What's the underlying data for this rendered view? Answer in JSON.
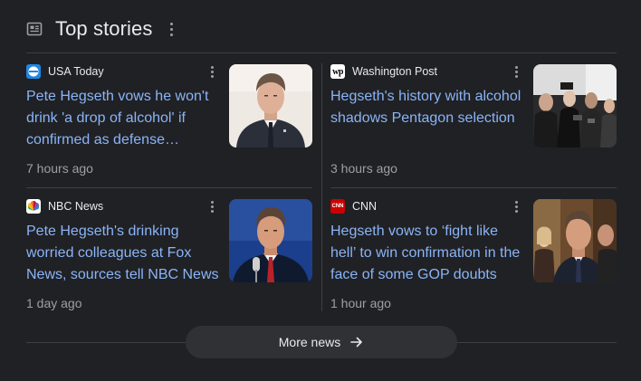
{
  "header": {
    "title": "Top stories",
    "icon": "news-icon"
  },
  "stories": [
    {
      "source": "USA Today",
      "logo_icon": "usa-today-logo",
      "logo_color": "#1e88e5",
      "headline": "Pete Hegseth vows he won't drink 'a drop of alcohol' if confirmed as defense…",
      "time": "7 hours ago"
    },
    {
      "source": "Washington Post",
      "logo_icon": "washington-post-logo",
      "logo_text": "wp",
      "logo_color": "#ffffff",
      "headline": "Hegseth's history with alcohol shadows Pentagon selection",
      "time": "3 hours ago"
    },
    {
      "source": "NBC News",
      "logo_icon": "nbc-peacock-logo",
      "logo_color": "#ffffff",
      "headline": "Pete Hegseth's drinking worried colleagues at Fox News, sources tell NBC News",
      "time": "1 day ago"
    },
    {
      "source": "CNN",
      "logo_icon": "cnn-logo",
      "logo_text": "CNN",
      "logo_color": "#cc0000",
      "headline": "Hegseth vows to ‘fight like hell’ to win confirmation in the face of some GOP doubts",
      "time": "1 hour ago"
    }
  ],
  "more_news": {
    "label": "More news",
    "icon": "arrow-right-icon"
  },
  "colors": {
    "background": "#202124",
    "headline": "#8ab4f8",
    "text": "#e8eaed",
    "muted": "#9aa0a6",
    "divider": "#3c4043",
    "button_bg": "#303134"
  }
}
